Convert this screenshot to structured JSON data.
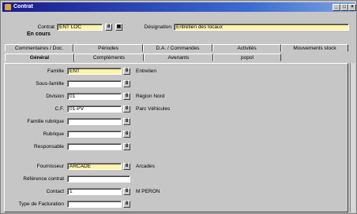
{
  "window": {
    "title": "Contrat",
    "buttons": [
      "_",
      "□",
      "×"
    ]
  },
  "header": {
    "contrat_label": "Contrat",
    "contrat_value": "ENT LOC",
    "status": "En cours",
    "designation_label": "Désignation",
    "designation_value": "Entretien des locaux"
  },
  "tabs_row1": [
    "Commentaires / Doc.",
    "Périodes",
    "D.A. / Commandes",
    "Activités",
    "Mouvements stock"
  ],
  "tabs_row2": [
    "Général",
    "Compléments",
    "Avenants",
    "popol"
  ],
  "active_tab": "Général",
  "form": {
    "famille": {
      "label": "Famille",
      "value": "ENT",
      "desc": "Entretien"
    },
    "sous_famille": {
      "label": "Sous-famille",
      "value": "",
      "desc": ""
    },
    "division": {
      "label": "Division",
      "value": "01",
      "desc": "Région Nord"
    },
    "cf": {
      "label": "C.F.",
      "value": "01-PV",
      "desc": "Parc Véhicules"
    },
    "famille_rubrique": {
      "label": "Famille rubrique",
      "value": "",
      "desc": ""
    },
    "rubrique": {
      "label": "Rubrique",
      "value": "",
      "desc": ""
    },
    "responsable": {
      "label": "Responsable",
      "value": "",
      "desc": ""
    },
    "fournisseur": {
      "label": "Fournisseur",
      "value": "ARCADE",
      "desc": "Arcades"
    },
    "reference_contrat": {
      "label": "Référence contrat",
      "value": ""
    },
    "contact": {
      "label": "Contact",
      "value": "1",
      "desc": "M PERON"
    },
    "type_facturation": {
      "label": "Type de Facturation",
      "value": "",
      "desc": ""
    }
  },
  "icons": {
    "lookup": "8",
    "card": "▣"
  },
  "colors": {
    "title_start": "#1a1a8c",
    "title_end": "#7aa0e0",
    "highlight_field": "#fff4a8"
  }
}
